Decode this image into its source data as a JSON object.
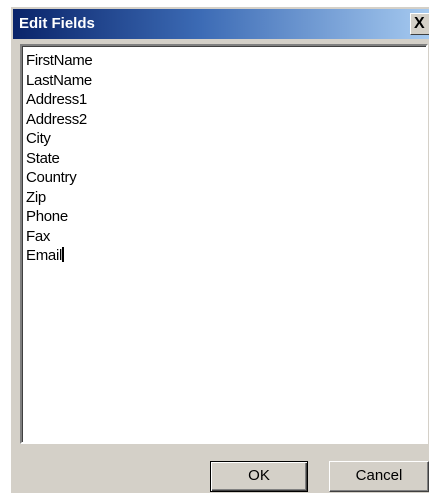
{
  "window": {
    "title": "Edit Fields",
    "close_glyph": "X",
    "close_icon": "close-icon"
  },
  "fields": {
    "lines": [
      "FirstName",
      "LastName",
      "Address1",
      "Address2",
      "City",
      "State",
      "Country",
      "Zip",
      "Phone",
      "Fax",
      "Email"
    ]
  },
  "buttons": {
    "ok_label": "OK",
    "cancel_label": "Cancel"
  },
  "colors": {
    "titlebar_start": "#0a246a",
    "titlebar_end": "#a6caf0",
    "dialog_face": "#d4d0c8"
  }
}
